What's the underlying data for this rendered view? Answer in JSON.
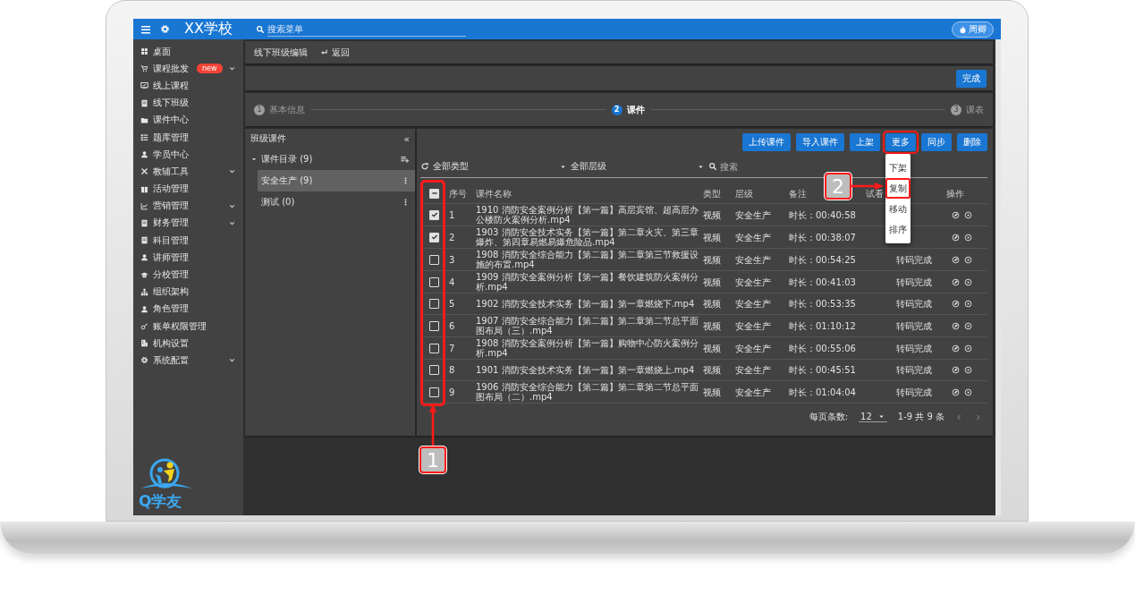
{
  "topbar": {
    "title": "XX学校",
    "search_placeholder": "搜索菜单",
    "user": "周卿"
  },
  "sidebar": {
    "items": [
      {
        "label": "桌面",
        "has_submenu": false
      },
      {
        "label": "课程批发",
        "badge": "new",
        "has_submenu": true
      },
      {
        "label": "线上课程",
        "has_submenu": false
      },
      {
        "label": "线下班级",
        "has_submenu": false
      },
      {
        "label": "课件中心",
        "has_submenu": false
      },
      {
        "label": "题库管理",
        "has_submenu": false
      },
      {
        "label": "学员中心",
        "has_submenu": false
      },
      {
        "label": "教辅工具",
        "has_submenu": true
      },
      {
        "label": "活动管理",
        "has_submenu": false
      },
      {
        "label": "营销管理",
        "has_submenu": true
      },
      {
        "label": "财务管理",
        "has_submenu": true
      },
      {
        "label": "科目管理",
        "has_submenu": false
      },
      {
        "label": "讲师管理",
        "has_submenu": false
      },
      {
        "label": "分校管理",
        "has_submenu": false
      },
      {
        "label": "组织架构",
        "has_submenu": false
      },
      {
        "label": "角色管理",
        "has_submenu": false
      },
      {
        "label": "账单权限管理",
        "has_submenu": false
      },
      {
        "label": "机构设置",
        "has_submenu": false
      },
      {
        "label": "系统配置",
        "has_submenu": true
      }
    ],
    "logo": "Q学友"
  },
  "breadcrumb": {
    "title": "线下班级编辑",
    "back": "返回"
  },
  "done_button": "完成",
  "steps": [
    {
      "number": "1",
      "label": "基本信息",
      "active": false
    },
    {
      "number": "2",
      "label": "课件",
      "active": true
    },
    {
      "number": "3",
      "label": "课表",
      "active": false
    }
  ],
  "left_panel": {
    "title": "班级课件",
    "collapse": "«",
    "tree": [
      {
        "label": "课件目录 (9)",
        "expanded": true,
        "children": [
          {
            "label": "安全生产 (9)",
            "selected": true
          },
          {
            "label": "测试 (0)",
            "selected": false
          }
        ]
      }
    ]
  },
  "toolbar": [
    {
      "label": "上传课件",
      "highlighted": false
    },
    {
      "label": "导入课件",
      "highlighted": false
    },
    {
      "label": "上架",
      "highlighted": false
    },
    {
      "label": "更多",
      "highlighted": true,
      "menu": [
        {
          "label": "下架",
          "highlighted": false
        },
        {
          "label": "复制",
          "highlighted": true
        },
        {
          "label": "移动",
          "highlighted": false
        },
        {
          "label": "排序",
          "highlighted": false
        }
      ]
    },
    {
      "label": "同步",
      "highlighted": false
    },
    {
      "label": "删除",
      "highlighted": false
    }
  ],
  "filters": {
    "type": "全部类型",
    "level": "全部层级",
    "search_placeholder": "搜索"
  },
  "table": {
    "header_checkbox": {
      "indeterminate": true
    },
    "checkbox_column_highlighted": true,
    "columns": [
      "序号",
      "课件名称",
      "类型",
      "层级",
      "备注",
      "试看",
      "操作"
    ],
    "rows": [
      {
        "checked": true,
        "number": "1",
        "name": "1910 消防安全案例分析【第一篇】高层宾馆、超高层办公楼防火案例分析.mp4",
        "type": "视频",
        "level": "安全生产",
        "note": "时长：00:40:58"
      },
      {
        "checked": true,
        "number": "2",
        "name": "1903 消防安全技术实务【第一篇】第二章火灾、第三章爆炸、第四章易燃易爆危险品.mp4",
        "type": "视频",
        "level": "安全生产",
        "note": "时长：00:38:07"
      },
      {
        "checked": false,
        "number": "3",
        "name": "1908 消防安全综合能力【第二篇】第二章第三节救援设施的布置.mp4",
        "type": "视频",
        "level": "安全生产",
        "note": "时长：00:54:25",
        "status": "转码完成"
      },
      {
        "checked": false,
        "number": "4",
        "name": "1909 消防安全案例分析【第一篇】餐饮建筑防火案例分析.mp4",
        "type": "视频",
        "level": "安全生产",
        "note": "时长：00:41:03",
        "status": "转码完成"
      },
      {
        "checked": false,
        "number": "5",
        "name": "1902 消防安全技术实务【第一篇】第一章燃烧下.mp4",
        "type": "视频",
        "level": "安全生产",
        "note": "时长：00:53:35",
        "status": "转码完成"
      },
      {
        "checked": false,
        "number": "6",
        "name": "1907 消防安全综合能力【第二篇】第二章第二节总平面图布局（三）.mp4",
        "type": "视频",
        "level": "安全生产",
        "note": "时长：01:10:12",
        "status": "转码完成"
      },
      {
        "checked": false,
        "number": "7",
        "name": "1908 消防安全案例分析【第一篇】购物中心防火案例分析.mp4",
        "type": "视频",
        "level": "安全生产",
        "note": "时长：00:55:06",
        "status": "转码完成"
      },
      {
        "checked": false,
        "number": "8",
        "name": "1901 消防安全技术实务【第一篇】第一章燃烧上.mp4",
        "type": "视频",
        "level": "安全生产",
        "note": "时长：00:45:51",
        "status": "转码完成"
      },
      {
        "checked": false,
        "number": "9",
        "name": "1906 消防安全综合能力【第二篇】第二章第二节总平面图布局（二）.mp4",
        "type": "视频",
        "level": "安全生产",
        "note": "时长：01:04:04",
        "status": "转码完成"
      }
    ]
  },
  "pagination": {
    "label": "每页条数:",
    "per_page": "12",
    "range": "1-9 共 9 条"
  },
  "callouts": [
    {
      "number": "1"
    },
    {
      "number": "2"
    }
  ]
}
